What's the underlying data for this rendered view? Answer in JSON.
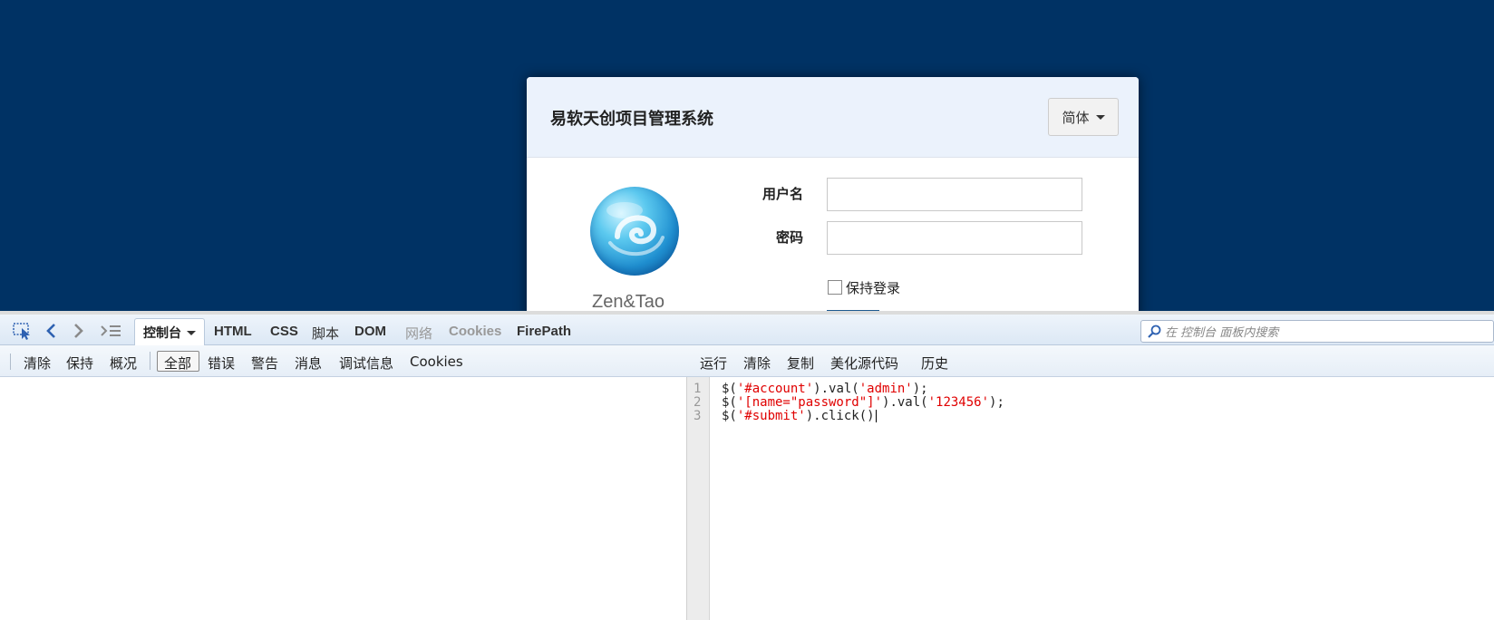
{
  "login": {
    "title": "易软天创项目管理系统",
    "lang_button": "简体",
    "logo_text": "Zen&Tao",
    "username_label": "用户名",
    "password_label": "密码",
    "remember_label": "保持登录"
  },
  "devtools": {
    "tabs": {
      "console": "控制台",
      "html": "HTML",
      "css": "CSS",
      "script": "脚本",
      "dom": "DOM",
      "net": "网络",
      "cookies": "Cookies",
      "firepath": "FirePath"
    },
    "search_placeholder": "在 控制台 面板内搜索",
    "toolbar_left": {
      "clear": "清除",
      "persist": "保持",
      "profile": "概况",
      "all": "全部",
      "errors": "错误",
      "warnings": "警告",
      "info": "消息",
      "debug": "调试信息",
      "cookies": "Cookies"
    },
    "toolbar_right": {
      "run": "运行",
      "clear": "清除",
      "copy": "复制",
      "pretty": "美化源代码",
      "history": "历史"
    },
    "gutter": [
      "1",
      "2",
      "3"
    ],
    "code": [
      [
        {
          "t": "$(",
          "c": "plain"
        },
        {
          "t": "'#account'",
          "c": "str"
        },
        {
          "t": ").val(",
          "c": "plain"
        },
        {
          "t": "'admin'",
          "c": "str"
        },
        {
          "t": ");",
          "c": "plain"
        }
      ],
      [
        {
          "t": "$(",
          "c": "plain"
        },
        {
          "t": "'[name=\"password\"]'",
          "c": "str"
        },
        {
          "t": ").val(",
          "c": "plain"
        },
        {
          "t": "'123456'",
          "c": "str"
        },
        {
          "t": ");",
          "c": "plain"
        }
      ],
      [
        {
          "t": "$(",
          "c": "plain"
        },
        {
          "t": "'#submit'",
          "c": "str"
        },
        {
          "t": ").click()",
          "c": "plain"
        }
      ]
    ]
  },
  "colors": {
    "page_background": "#003264",
    "header_background": "#ebf2fc",
    "string": "#e00000"
  }
}
